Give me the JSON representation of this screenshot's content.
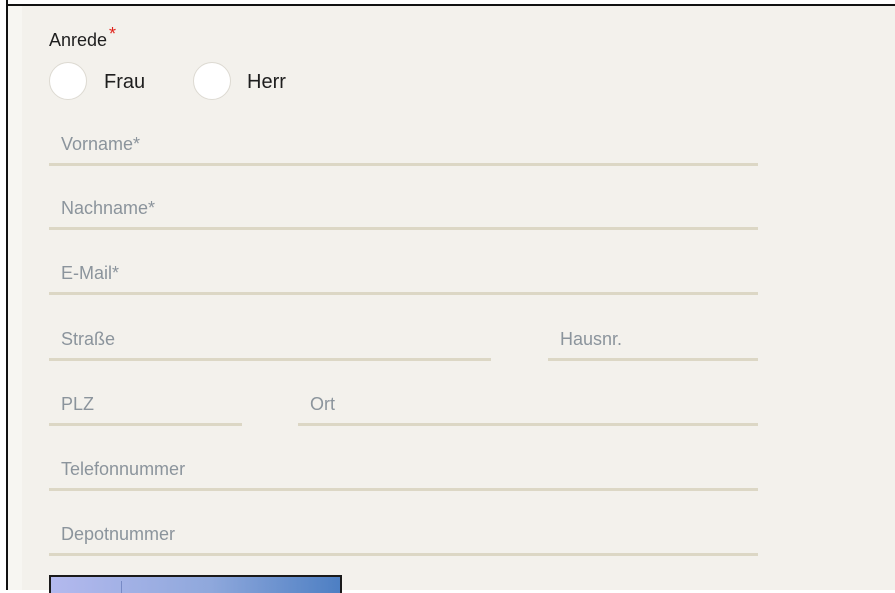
{
  "form": {
    "salutation": {
      "label": "Anrede",
      "required_marker": "*",
      "options": [
        {
          "label": "Frau",
          "selected": false
        },
        {
          "label": "Herr",
          "selected": false
        }
      ]
    },
    "fields": {
      "first_name": {
        "placeholder": "Vorname*",
        "value": ""
      },
      "last_name": {
        "placeholder": "Nachname*",
        "value": ""
      },
      "email": {
        "placeholder": "E-Mail*",
        "value": ""
      },
      "street": {
        "placeholder": "Straße",
        "value": ""
      },
      "house_number": {
        "placeholder": "Hausnr.",
        "value": ""
      },
      "postal_code": {
        "placeholder": "PLZ",
        "value": ""
      },
      "city": {
        "placeholder": "Ort",
        "value": ""
      },
      "phone": {
        "placeholder": "Telefonnummer",
        "value": ""
      },
      "depot_number": {
        "placeholder": "Depotnummer",
        "value": ""
      }
    }
  },
  "colors": {
    "panel_background": "#f3f1ec",
    "field_underline": "#dcd7c5",
    "placeholder_text": "#8b949c",
    "label_text": "#1e1e1e",
    "required_star": "#e0231b",
    "radio_fill": "#ffffff"
  }
}
